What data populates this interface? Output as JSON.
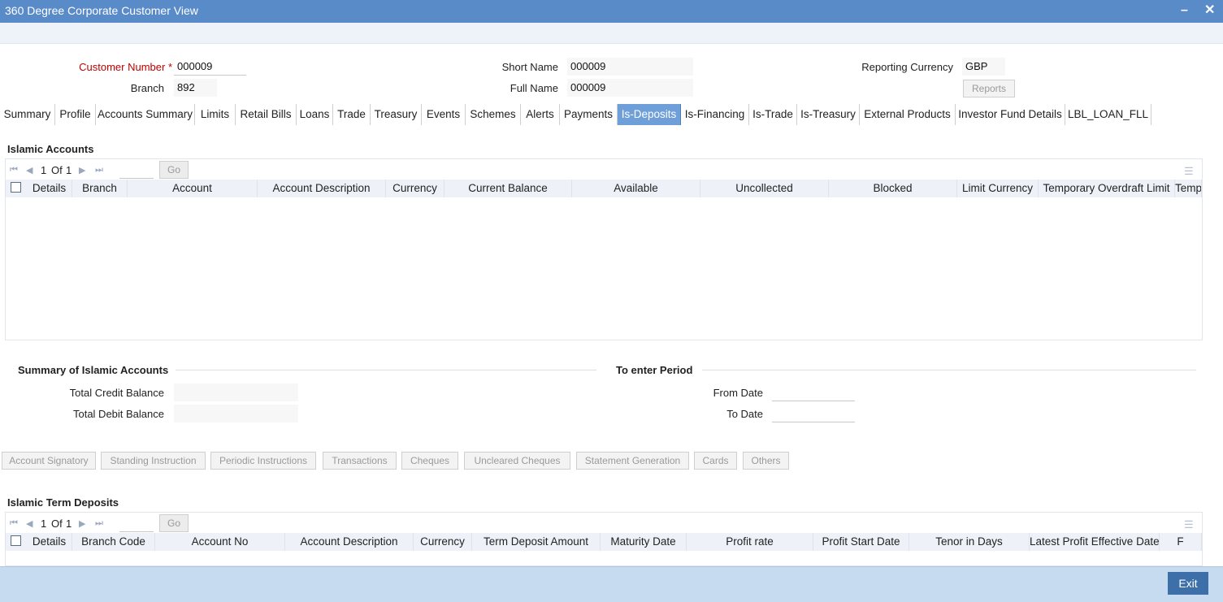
{
  "window": {
    "title": "360 Degree Corporate Customer View",
    "minimize": "–",
    "close": "✕"
  },
  "header": {
    "customer_number_label": "Customer Number",
    "required_mark": "*",
    "customer_number": "000009",
    "branch_label": "Branch",
    "branch": "892",
    "short_name_label": "Short Name",
    "short_name": "000009",
    "full_name_label": "Full Name",
    "full_name": "000009",
    "reporting_currency_label": "Reporting Currency",
    "reporting_currency": "GBP",
    "reports_button": "Reports"
  },
  "tabs": [
    {
      "label": "Summary"
    },
    {
      "label": "Profile"
    },
    {
      "label": "Accounts Summary"
    },
    {
      "label": "Limits"
    },
    {
      "label": "Retail Bills"
    },
    {
      "label": "Loans"
    },
    {
      "label": "Trade"
    },
    {
      "label": "Treasury"
    },
    {
      "label": "Events"
    },
    {
      "label": "Schemes"
    },
    {
      "label": "Alerts"
    },
    {
      "label": "Payments"
    },
    {
      "label": "Is-Deposits"
    },
    {
      "label": "Is-Financing"
    },
    {
      "label": "Is-Trade"
    },
    {
      "label": "Is-Treasury"
    },
    {
      "label": "External Products"
    },
    {
      "label": "Investor Fund Details"
    },
    {
      "label": "LBL_LOAN_FLL"
    }
  ],
  "active_tab": "Is-Deposits",
  "islamic_accounts": {
    "title": "Islamic Accounts",
    "pager": {
      "current": "1",
      "of_label": "Of",
      "total": "1",
      "go": "Go"
    },
    "columns": [
      "Details",
      "Branch",
      "Account",
      "Account Description",
      "Currency",
      "Current Balance",
      "Available",
      "Uncollected",
      "Blocked",
      "Limit Currency",
      "Temporary Overdraft Limit",
      "Tempo"
    ]
  },
  "summary": {
    "title": "Summary of Islamic Accounts",
    "total_credit_label": "Total Credit Balance",
    "total_credit": "",
    "total_debit_label": "Total Debit Balance",
    "total_debit": ""
  },
  "period": {
    "title": "To enter Period",
    "from_label": "From Date",
    "from_value": "",
    "to_label": "To Date",
    "to_value": ""
  },
  "actions": [
    "Account Signatory",
    "Standing Instruction",
    "Periodic Instructions",
    "Transactions",
    "Cheques",
    "Uncleared Cheques",
    "Statement Generation",
    "Cards",
    "Others"
  ],
  "term_deposits": {
    "title": "Islamic Term Deposits",
    "pager": {
      "current": "1",
      "of_label": "Of",
      "total": "1",
      "go": "Go"
    },
    "columns": [
      "Details",
      "Branch Code",
      "Account No",
      "Account Description",
      "Currency",
      "Term Deposit Amount",
      "Maturity Date",
      "Profit rate",
      "Profit Start Date",
      "Tenor in Days",
      "Latest Profit Effective Date",
      "F"
    ]
  },
  "footer": {
    "exit": "Exit"
  }
}
